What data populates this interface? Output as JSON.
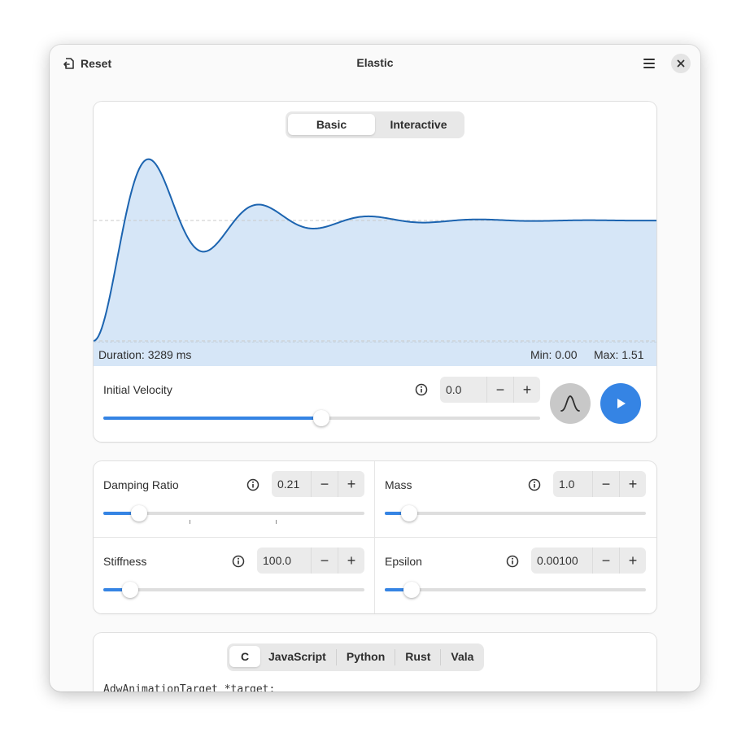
{
  "header": {
    "reset_label": "Reset",
    "title": "Elastic",
    "icons": {
      "reset": "undo-icon",
      "menu": "hamburger-menu-icon",
      "close": "close-icon"
    }
  },
  "graph_card": {
    "tabs": [
      {
        "label": "Basic",
        "active": true
      },
      {
        "label": "Interactive",
        "active": false
      }
    ],
    "duration": "Duration: 3289 ms",
    "min": "Min: 0.00",
    "max": "Max: 1.51",
    "initial_velocity": {
      "label": "Initial Velocity",
      "value": "0.0",
      "slider_fraction": 0.5
    },
    "curve_button_icon": "bell-curve-icon",
    "play_button_icon": "play-icon"
  },
  "params": {
    "damping_ratio": {
      "label": "Damping Ratio",
      "value": "0.21",
      "slider_fraction": 0.14
    },
    "mass": {
      "label": "Mass",
      "value": "1.0",
      "slider_fraction": 0.09
    },
    "stiffness": {
      "label": "Stiffness",
      "value": "100.0",
      "slider_fraction": 0.1
    },
    "epsilon": {
      "label": "Epsilon",
      "value": "0.00100",
      "slider_fraction": 0.1
    }
  },
  "code_card": {
    "tabs": [
      {
        "label": "C",
        "active": true
      },
      {
        "label": "JavaScript",
        "active": false
      },
      {
        "label": "Python",
        "active": false
      },
      {
        "label": "Rust",
        "active": false
      },
      {
        "label": "Vala",
        "active": false
      }
    ],
    "code_line": "AdwAnimationTarget *target;"
  },
  "colors": {
    "accent": "#3584e4",
    "curve": "#1c64b0",
    "curve_fill": "#d6e6f7"
  }
}
